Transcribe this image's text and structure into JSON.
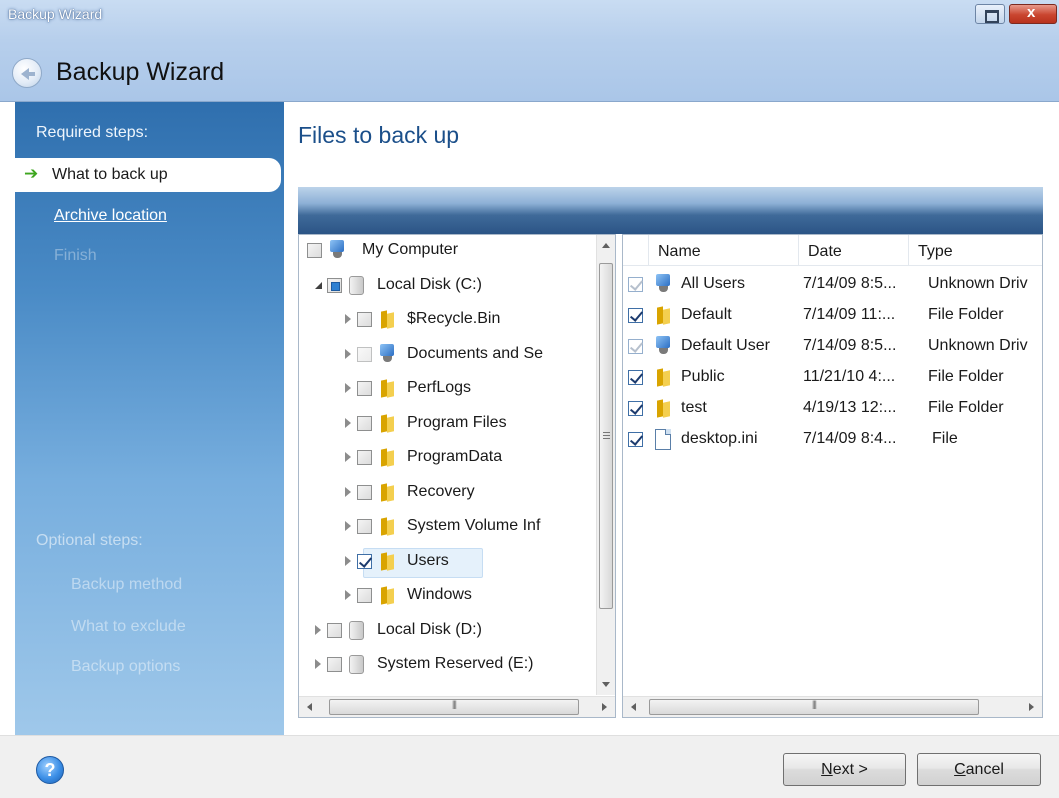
{
  "window": {
    "title": "Backup Wizard",
    "heading": "Backup Wizard",
    "close_glyph": "x",
    "close_color": "#c9452f"
  },
  "steps": {
    "required_label": "Required steps:",
    "items": [
      {
        "label": "What to back up",
        "state": "current"
      },
      {
        "label": "Archive location",
        "state": "link"
      },
      {
        "label": "Finish",
        "state": "disabled"
      }
    ],
    "optional_label": "Optional steps:",
    "optional_items": [
      {
        "label": "Backup method"
      },
      {
        "label": "What to exclude"
      },
      {
        "label": "Backup options"
      }
    ]
  },
  "main": {
    "title": "Files to back up",
    "title_color": "#1b4f8a"
  },
  "tree": {
    "items": [
      {
        "label": "My Computer",
        "icon": "computer-icon",
        "expander": "none",
        "check": "unchecked"
      },
      {
        "label": "Local Disk (C:)",
        "icon": "disk-icon",
        "expander": "open",
        "check": "partial"
      },
      {
        "label": "$Recycle.Bin",
        "icon": "folder-icon",
        "expander": "closed",
        "check": "unchecked"
      },
      {
        "label": "Documents and Se",
        "icon": "computer-icon",
        "expander": "closed",
        "check": "unchecked-dim"
      },
      {
        "label": "PerfLogs",
        "icon": "folder-icon",
        "expander": "closed",
        "check": "unchecked"
      },
      {
        "label": "Program Files",
        "icon": "folder-icon",
        "expander": "closed",
        "check": "unchecked"
      },
      {
        "label": "ProgramData",
        "icon": "folder-icon",
        "expander": "closed",
        "check": "unchecked"
      },
      {
        "label": "Recovery",
        "icon": "folder-icon",
        "expander": "closed",
        "check": "unchecked"
      },
      {
        "label": "System Volume Inf",
        "icon": "folder-icon",
        "expander": "closed",
        "check": "unchecked"
      },
      {
        "label": "Users",
        "icon": "folder-icon",
        "expander": "closed",
        "check": "checked",
        "selected": true
      },
      {
        "label": "Windows",
        "icon": "folder-icon",
        "expander": "closed",
        "check": "unchecked"
      },
      {
        "label": "Local Disk (D:)",
        "icon": "disk-icon",
        "expander": "closed",
        "check": "unchecked"
      },
      {
        "label": "System Reserved (E:)",
        "icon": "disk-icon",
        "expander": "closed",
        "check": "unchecked"
      }
    ]
  },
  "list": {
    "columns": [
      "Name",
      "Date",
      "Type"
    ],
    "rows": [
      {
        "name": "All Users",
        "date": "7/14/09 8:5...",
        "type": "Unknown Driv",
        "icon": "computer-icon",
        "check": "checked-dim"
      },
      {
        "name": "Default",
        "date": "7/14/09 11:...",
        "type": "File Folder",
        "icon": "folder-icon",
        "check": "checked"
      },
      {
        "name": "Default User",
        "date": "7/14/09 8:5...",
        "type": "Unknown Driv",
        "icon": "computer-icon",
        "check": "checked-dim"
      },
      {
        "name": "Public",
        "date": "11/21/10 4:...",
        "type": "File Folder",
        "icon": "folder-icon",
        "check": "checked"
      },
      {
        "name": "test",
        "date": "4/19/13 12:...",
        "type": "File Folder",
        "icon": "folder-icon",
        "check": "checked"
      },
      {
        "name": "desktop.ini",
        "date": "7/14/09 8:4...",
        "type": "File",
        "icon": "file-icon",
        "check": "checked"
      }
    ]
  },
  "footer": {
    "help_glyph": "?",
    "next_label": "ext >",
    "next_mnemonic": "N",
    "cancel_label": "ancel",
    "cancel_mnemonic": "C"
  }
}
